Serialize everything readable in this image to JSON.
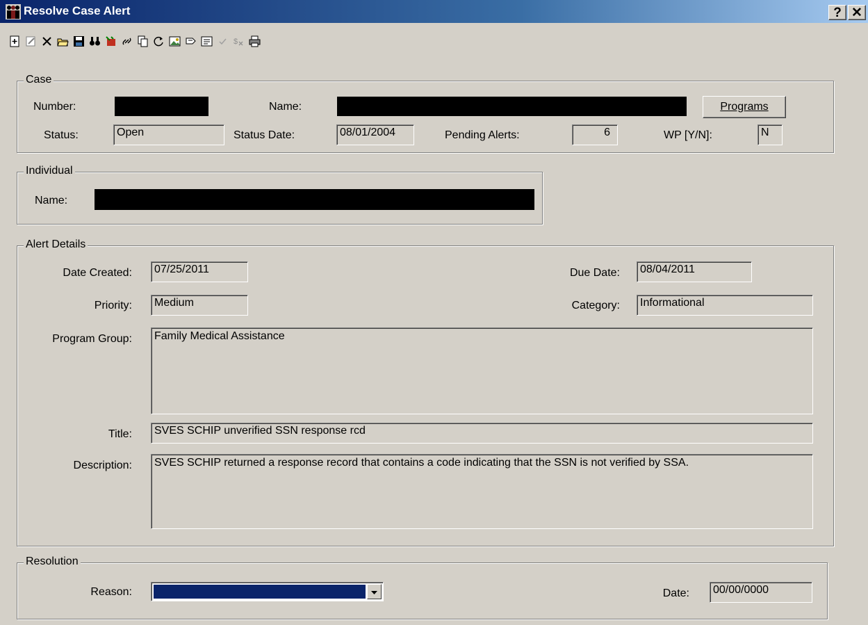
{
  "window": {
    "title": "Resolve Case Alert",
    "help_label": "?",
    "close_label": "✕"
  },
  "toolbar": {
    "icons": [
      "new-icon",
      "edit-icon",
      "delete-icon",
      "open-folder-icon",
      "save-icon",
      "find-binoculars-icon",
      "tools-icon",
      "link-icon",
      "copy-icon",
      "refresh-icon",
      "image-icon",
      "flip-icon",
      "form-icon",
      "check-icon",
      "currency-icon",
      "print-icon"
    ]
  },
  "case": {
    "legend": "Case",
    "number_label": "Number:",
    "name_label": "Name:",
    "programs_label": "Programs",
    "status_label": "Status:",
    "status_value": "Open",
    "status_date_label": "Status Date:",
    "status_date_value": "08/01/2004",
    "pending_alerts_label": "Pending Alerts:",
    "pending_alerts_value": "6",
    "wp_label": "WP [Y/N]:",
    "wp_value": "N"
  },
  "individual": {
    "legend": "Individual",
    "name_label": "Name:"
  },
  "alert": {
    "legend": "Alert Details",
    "date_created_label": "Date Created:",
    "date_created_value": "07/25/2011",
    "due_date_label": "Due Date:",
    "due_date_value": "08/04/2011",
    "priority_label": "Priority:",
    "priority_value": "Medium",
    "category_label": "Category:",
    "category_value": "Informational",
    "program_group_label": "Program Group:",
    "program_group_value": "Family Medical Assistance",
    "title_label": "Title:",
    "title_value": "SVES SCHIP unverified SSN response rcd",
    "description_label": "Description:",
    "description_value": "SVES SCHIP returned a response record that contains a code indicating that the SSN is not verified by SSA."
  },
  "resolution": {
    "legend": "Resolution",
    "reason_label": "Reason:",
    "date_label": "Date:",
    "date_value": "00/00/0000"
  },
  "colors": {
    "titlebar_start": "#0a246a",
    "face": "#d4d0c8",
    "selection": "#0a246a"
  }
}
